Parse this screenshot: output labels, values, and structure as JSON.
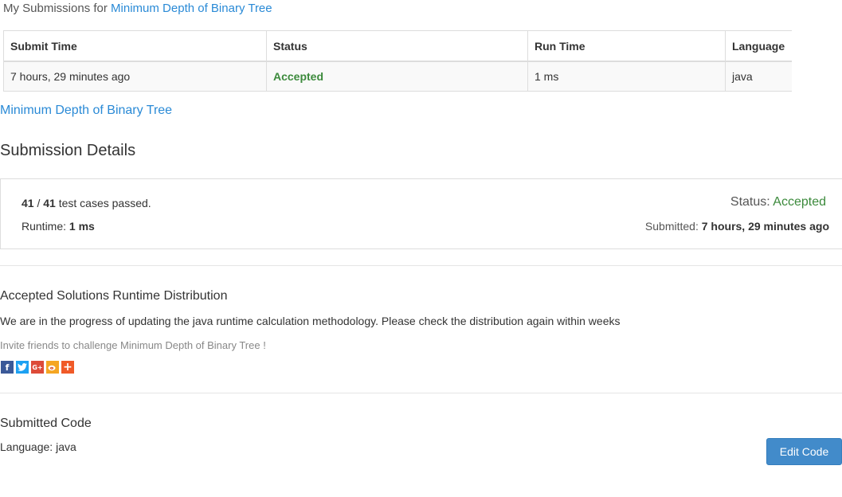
{
  "header": {
    "prefix": "My Submissions for",
    "problem_link": "Minimum Depth of Binary Tree"
  },
  "submissions_table": {
    "columns": [
      "Submit Time",
      "Status",
      "Run Time",
      "Language"
    ],
    "rows": [
      {
        "submit_time": "7 hours, 29 minutes ago",
        "status": "Accepted",
        "run_time": "1 ms",
        "language": "java"
      }
    ]
  },
  "problem_link": "Minimum Depth of Binary Tree",
  "details": {
    "title": "Submission Details",
    "passed": "41",
    "total": "41",
    "passed_suffix": "test cases passed.",
    "runtime_label": "Runtime:",
    "runtime_value": "1 ms",
    "status_label": "Status:",
    "status_value": "Accepted",
    "submitted_label": "Submitted:",
    "submitted_value": "7 hours, 29 minutes ago"
  },
  "distribution": {
    "title": "Accepted Solutions Runtime Distribution",
    "note": "We are in the progress of updating the java runtime calculation methodology. Please check the distribution again within weeks",
    "invite": "Invite friends to challenge Minimum Depth of Binary Tree !",
    "share_icons": [
      "facebook-icon",
      "twitter-icon",
      "google-plus-icon",
      "weibo-icon",
      "more-share-icon"
    ]
  },
  "code": {
    "title": "Submitted Code",
    "language_label": "Language:",
    "language_value": "java",
    "edit_button": "Edit Code"
  },
  "colors": {
    "link": "#2a8ad6",
    "accepted": "#3c8a3c",
    "button": "#428bca"
  }
}
